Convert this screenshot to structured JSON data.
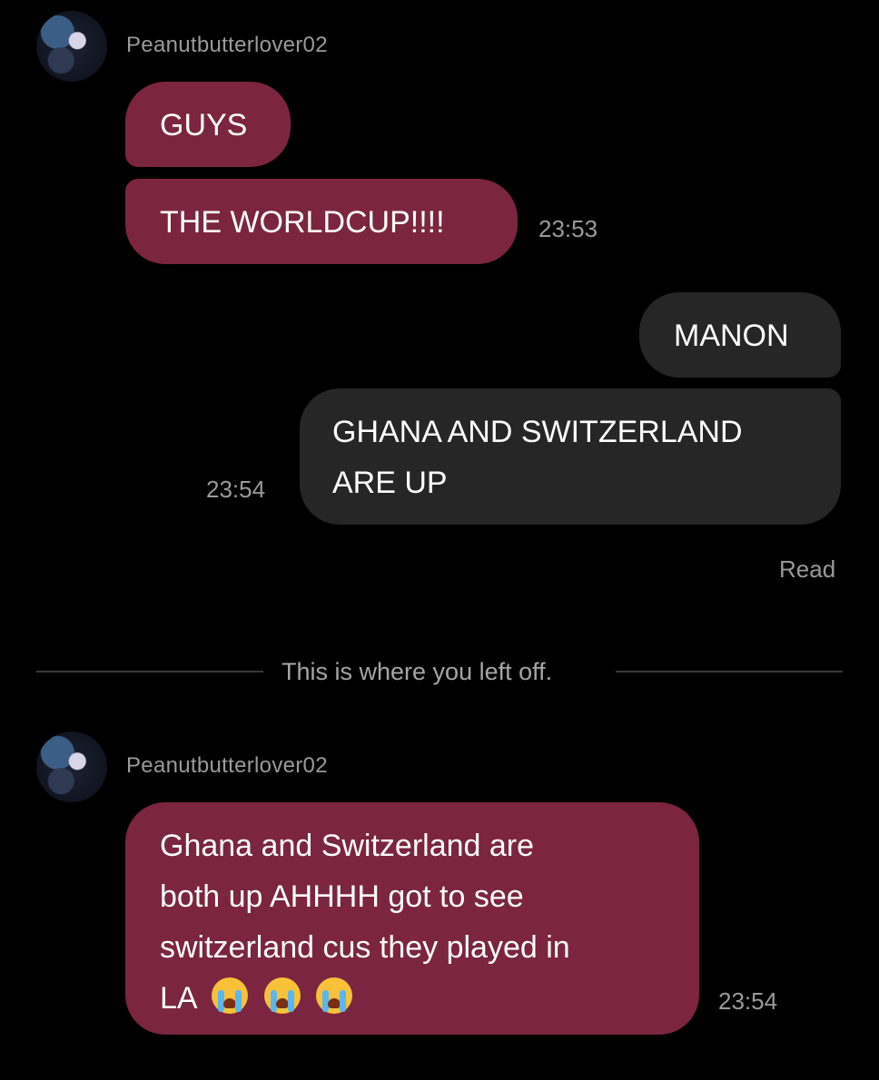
{
  "colors": {
    "background": "#000000",
    "incoming_bubble": "#7b2540",
    "outgoing_bubble": "#262626",
    "meta_text": "#9a9a9a"
  },
  "thread": {
    "group1": {
      "username": "Peanutbutterlover02",
      "messages": [
        "GUYS",
        "THE WORLDCUP!!!!"
      ],
      "time": "23:53"
    },
    "outgoing": {
      "messages": [
        "MANON",
        "GHANA AND SWITZERLAND",
        "ARE UP"
      ],
      "time": "23:54",
      "status": "Read"
    },
    "divider": "This is where you left off.",
    "group2": {
      "username": "Peanutbutterlover02",
      "lines": [
        "Ghana and Switzerland are",
        "both up AHHHH got to see",
        "switzerland cus they played in",
        "LA"
      ],
      "emoji": [
        "loudly-crying-face",
        "loudly-crying-face",
        "loudly-crying-face"
      ],
      "time": "23:54"
    }
  }
}
